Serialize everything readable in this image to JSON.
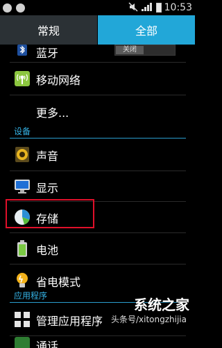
{
  "status": {
    "time": "10:53",
    "icons": [
      "android-notification-icon",
      "sync-icon",
      "mute-icon",
      "signal-3g-icon",
      "battery-icon"
    ]
  },
  "tabs": [
    {
      "label": "常规",
      "active": false
    },
    {
      "label": "全部",
      "active": true
    }
  ],
  "items": [
    {
      "label": "蓝牙",
      "icon": "bluetooth-icon",
      "toggle": "关闭"
    },
    {
      "label": "移动网络",
      "icon": "mobile-network-icon"
    },
    {
      "label": "更多...",
      "icon": ""
    }
  ],
  "sections": {
    "device": "设备",
    "apps": "应用程序"
  },
  "device_items": [
    {
      "label": "声音",
      "icon": "speaker-icon"
    },
    {
      "label": "显示",
      "icon": "monitor-icon"
    },
    {
      "label": "存储",
      "icon": "storage-pie-icon"
    },
    {
      "label": "电池",
      "icon": "battery-icon"
    },
    {
      "label": "省电模式",
      "icon": "bulb-icon"
    }
  ],
  "app_items": [
    {
      "label": "管理应用程序",
      "icon": "apps-grid-icon"
    },
    {
      "label": "通话",
      "icon": "phone-icon"
    }
  ],
  "watermark": {
    "title": "系统之家",
    "subtitle": "头条号/xitongzhijia"
  },
  "colors": {
    "accent": "#22a7d8",
    "highlight": "#e0102a"
  }
}
